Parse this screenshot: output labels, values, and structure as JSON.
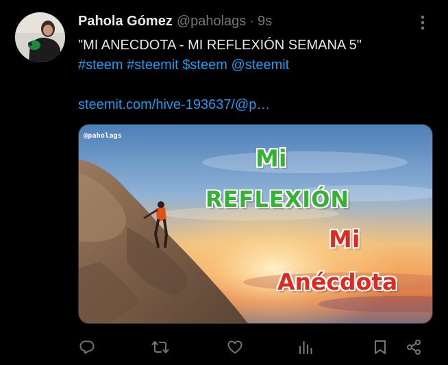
{
  "tweet": {
    "display_name": "Pahola Gómez",
    "handle": "@paholags",
    "separator": "·",
    "time": "9s",
    "text_line1": "\"MI ANECDOTA - MI REFLEXIÓN SEMANA 5\"",
    "hashtags": [
      "#steem",
      "#steemit"
    ],
    "cashtag": "$steem",
    "mention": "@steemit",
    "link": "steemit.com/hive-193637/@p…"
  },
  "media": {
    "watermark": "@paholags",
    "words": [
      {
        "text": "Mi",
        "color": "green"
      },
      {
        "text": "REFLEXIÓN",
        "color": "green"
      },
      {
        "text": "Mi",
        "color": "red"
      },
      {
        "text": "Anécdota",
        "color": "red"
      }
    ]
  },
  "actions": [
    "reply-icon",
    "retweet-icon",
    "like-icon",
    "views-icon",
    "bookmark-icon",
    "share-icon"
  ],
  "colors": {
    "background": "#000000",
    "text": "#e7e9ea",
    "secondary": "#71767b",
    "link": "#1d9bf0",
    "green_title": "#33b233",
    "red_title": "#e02a1e"
  }
}
